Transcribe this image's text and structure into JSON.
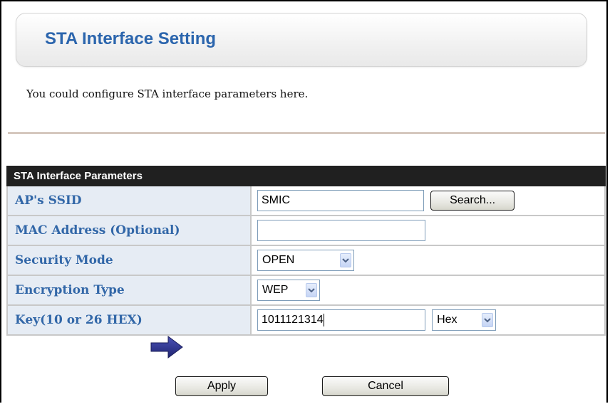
{
  "page": {
    "title": "STA Interface Setting",
    "description": "You could configure STA interface parameters here."
  },
  "section": {
    "header": "STA Interface Parameters"
  },
  "fields": {
    "ssid": {
      "label": "AP's SSID",
      "value": "SMIC",
      "search_label": "Search..."
    },
    "mac": {
      "label": "MAC Address (Optional)",
      "value": ""
    },
    "security": {
      "label": "Security Mode",
      "value": "OPEN"
    },
    "encryption": {
      "label": "Encryption Type",
      "value": "WEP"
    },
    "key": {
      "label": "Key(10 or 26 HEX)",
      "value": "1011121314",
      "format": "Hex"
    }
  },
  "buttons": {
    "apply": "Apply",
    "cancel": "Cancel"
  },
  "colors": {
    "title": "#2b65ad",
    "label": "#3267a8",
    "label_bg": "#e6ecf4",
    "header_bg": "#202020",
    "pointer": "#2a2f8f"
  },
  "icons": {
    "pointer": "arrow-right-icon",
    "dropdown": "chevron-down-icon"
  }
}
